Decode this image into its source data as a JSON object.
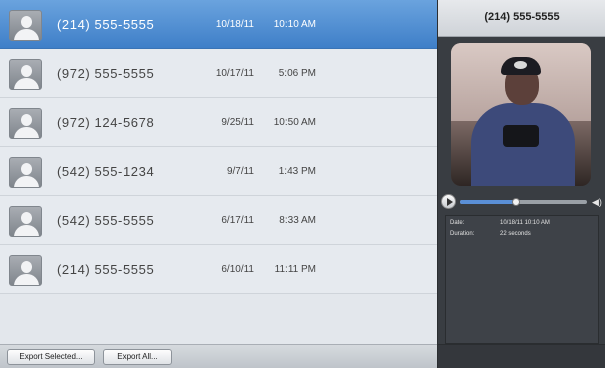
{
  "calls": [
    {
      "phone": "(214) 555-5555",
      "date": "10/18/11",
      "time": "10:10 AM",
      "selected": true
    },
    {
      "phone": "(972) 555-5555",
      "date": "10/17/11",
      "time": "5:06 PM",
      "selected": false
    },
    {
      "phone": "(972) 124-5678",
      "date": "9/25/11",
      "time": "10:50 AM",
      "selected": false
    },
    {
      "phone": "(542) 555-1234",
      "date": "9/7/11",
      "time": "1:43 PM",
      "selected": false
    },
    {
      "phone": "(542) 555-5555",
      "date": "6/17/11",
      "time": "8:33 AM",
      "selected": false
    },
    {
      "phone": "(214) 555-5555",
      "date": "6/10/11",
      "time": "11:11 PM",
      "selected": false
    }
  ],
  "toolbar": {
    "export_selected_label": "Export Selected...",
    "export_all_label": "Export All..."
  },
  "detail": {
    "title": "(214) 555-5555",
    "player": {
      "progress": 0.44,
      "play_icon": "play-icon",
      "volume_icon": "volume-icon"
    },
    "info": {
      "date_label": "Date:",
      "date_value": "10/18/11 10:10 AM",
      "duration_label": "Duration:",
      "duration_value": "22 seconds"
    }
  },
  "colors": {
    "selected_row": "#3f7fc8",
    "list_background": "#e6eaef",
    "detail_background": "#393d42"
  }
}
